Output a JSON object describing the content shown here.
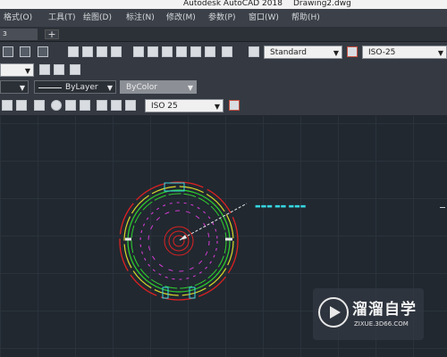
{
  "title_bar": {
    "app": "Autodesk AutoCAD 2018",
    "document": "Drawing2.dwg"
  },
  "menu": [
    "格式(O)",
    "工具(T)",
    "绘图(D)",
    "标注(N)",
    "修改(M)",
    "参数(P)",
    "窗口(W)",
    "帮助(H)"
  ],
  "file_tabs": {
    "active_partial": "ɜ",
    "new_tab": "+"
  },
  "styles_toolbar": {
    "text_style": "Standard",
    "dim_style": "ISO-25"
  },
  "properties_toolbar": {
    "linetype": "ByLayer",
    "plotstyle": "ByColor"
  },
  "dimension_toolbar": {
    "dim_style": "ISO 25"
  },
  "drawing": {
    "annotation_text": "▬▬▬ ▬▬ ▬▬▬",
    "colors": {
      "outer": "#dd2222",
      "yellow": "#d7d72a",
      "green": "#2fd32f",
      "cyan": "#36d6e0",
      "magenta": "#d23cd2",
      "white": "#e8e8e8"
    }
  },
  "watermark": {
    "brand": "溜溜自学",
    "url": "ZIXUE.3D66.COM"
  }
}
